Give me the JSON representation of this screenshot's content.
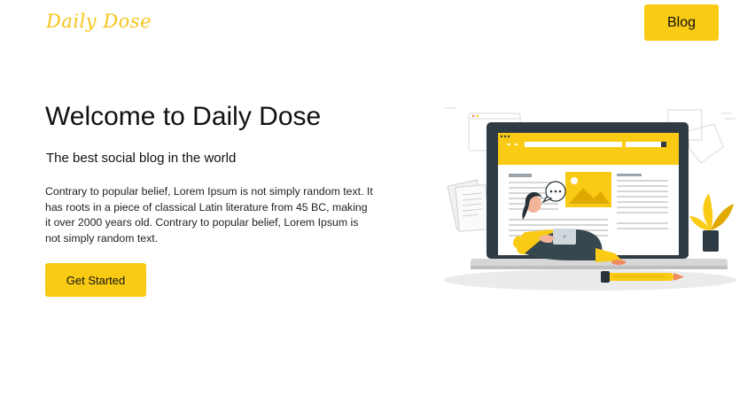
{
  "header": {
    "logo_text": "Daily Dose",
    "nav_button_label": "Blog"
  },
  "hero": {
    "title": "Welcome to Daily Dose",
    "subtitle": "The best social blog in the world",
    "body": "Contrary to popular belief, Lorem Ipsum is not simply random text. It has roots in a piece of classical Latin literature from 45 BC, making it over 2000 years old. Contrary to popular belief, Lorem Ipsum is not simply random text.",
    "cta_label": "Get Started"
  },
  "illustration": {
    "icon": "person-on-laptop-blogging-illustration",
    "accent_color": "#f9cb15"
  },
  "colors": {
    "accent": "#f9cb15",
    "logo": "#f5c518",
    "text": "#111111"
  }
}
